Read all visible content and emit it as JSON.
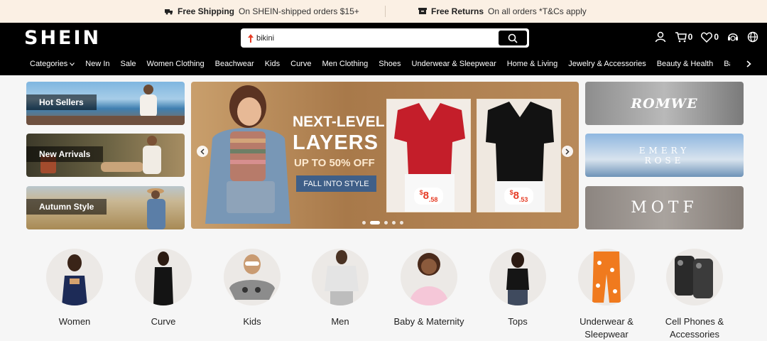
{
  "promo": {
    "shipping_title": "Free Shipping",
    "shipping_text": "On SHEIN-shipped orders $15+",
    "returns_title": "Free Returns",
    "returns_text": "On all orders *T&Cs apply"
  },
  "header": {
    "logo": "SHEIN",
    "search_value": "bikini",
    "cart_count": "0",
    "wishlist_count": "0"
  },
  "nav": {
    "items": [
      "Categories",
      "New In",
      "Sale",
      "Women Clothing",
      "Beachwear",
      "Kids",
      "Curve",
      "Men Clothing",
      "Shoes",
      "Underwear & Sleepwear",
      "Home & Living",
      "Jewelry & Accessories",
      "Beauty & Health",
      "Baby & M"
    ]
  },
  "tiles": {
    "hot_sellers": "Hot Sellers",
    "new_arrivals": "New Arrivals",
    "autumn_style": "Autumn Style"
  },
  "hero": {
    "line1": "NEXT-LEVEL",
    "line2": "LAYERS",
    "line3": "UP TO 50% OFF",
    "cta": "FALL INTO STYLE",
    "price1_currency": "$",
    "price1_whole": "8",
    "price1_cents": ".58",
    "price2_currency": "$",
    "price2_whole": "8",
    "price2_cents": ".53"
  },
  "brands": {
    "romwe": "ROMWE",
    "emery_line1": "EMERY",
    "emery_line2": "ROSE",
    "motf": "MOTF"
  },
  "categories": [
    {
      "label": "Women"
    },
    {
      "label": "Curve"
    },
    {
      "label": "Kids"
    },
    {
      "label": "Men"
    },
    {
      "label": "Baby & Maternity"
    },
    {
      "label": "Tops"
    },
    {
      "label": "Underwear & Sleepwear"
    },
    {
      "label": "Cell Phones & Accessories"
    }
  ],
  "colors": {
    "promo_bg": "#fbf0e4",
    "header_bg": "#000000",
    "cta_bg": "#3f5f88",
    "price_red": "#e63c25"
  }
}
